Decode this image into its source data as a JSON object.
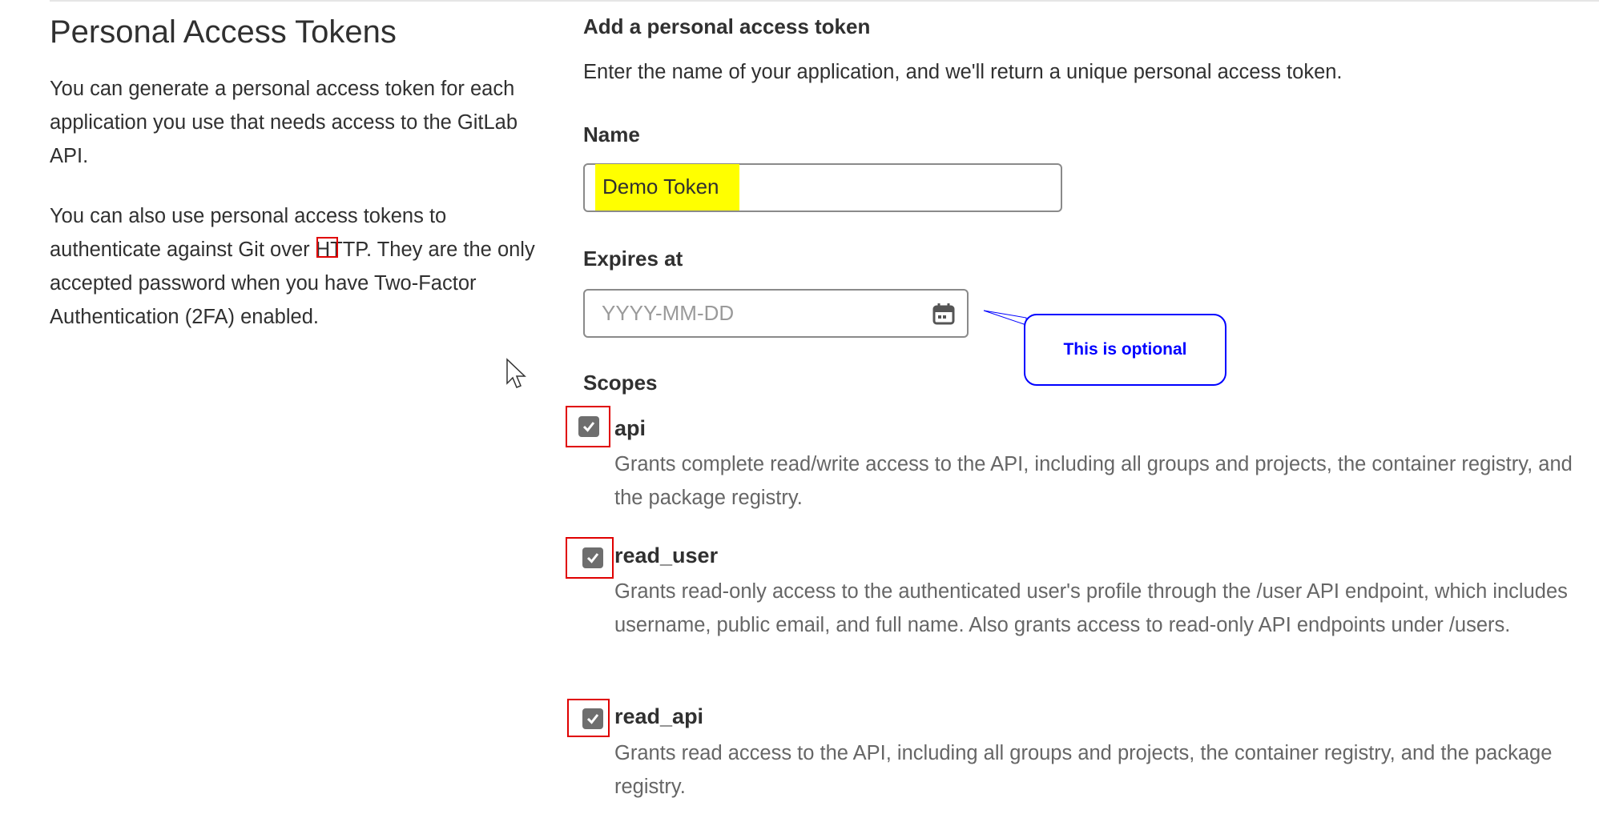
{
  "sidebar": {
    "title": "Personal Access Tokens",
    "paragraph1": "You can generate a personal access token for each application you use that needs access to the GitLab API.",
    "paragraph2": "You can also use personal access tokens to authenticate against Git over HTTP. They are the only accepted password when you have Two-Factor Authentication (2FA) enabled."
  },
  "form": {
    "heading": "Add a personal access token",
    "description": "Enter the name of your application, and we'll return a unique personal access token.",
    "name_label": "Name",
    "name_value": "Demo Token",
    "expires_label": "Expires at",
    "expires_placeholder": "YYYY-MM-DD",
    "expires_icon": "calendar-icon",
    "scopes_label": "Scopes",
    "scopes": [
      {
        "name": "api",
        "checked": true,
        "description": "Grants complete read/write access to the API, including all groups and projects, the container registry, and the package registry."
      },
      {
        "name": "read_user",
        "checked": true,
        "description": "Grants read-only access to the authenticated user's profile through the /user API endpoint, which includes username, public email, and full name. Also grants access to read-only API endpoints under /users."
      },
      {
        "name": "read_api",
        "checked": true,
        "description": "Grants read access to the API, including all groups and projects, the container registry, and the package registry."
      }
    ]
  },
  "annotation": {
    "callout_text": "This is optional",
    "callout_color": "#0000ff",
    "highlight_color": "#ffff00",
    "box_color": "#e00000"
  }
}
